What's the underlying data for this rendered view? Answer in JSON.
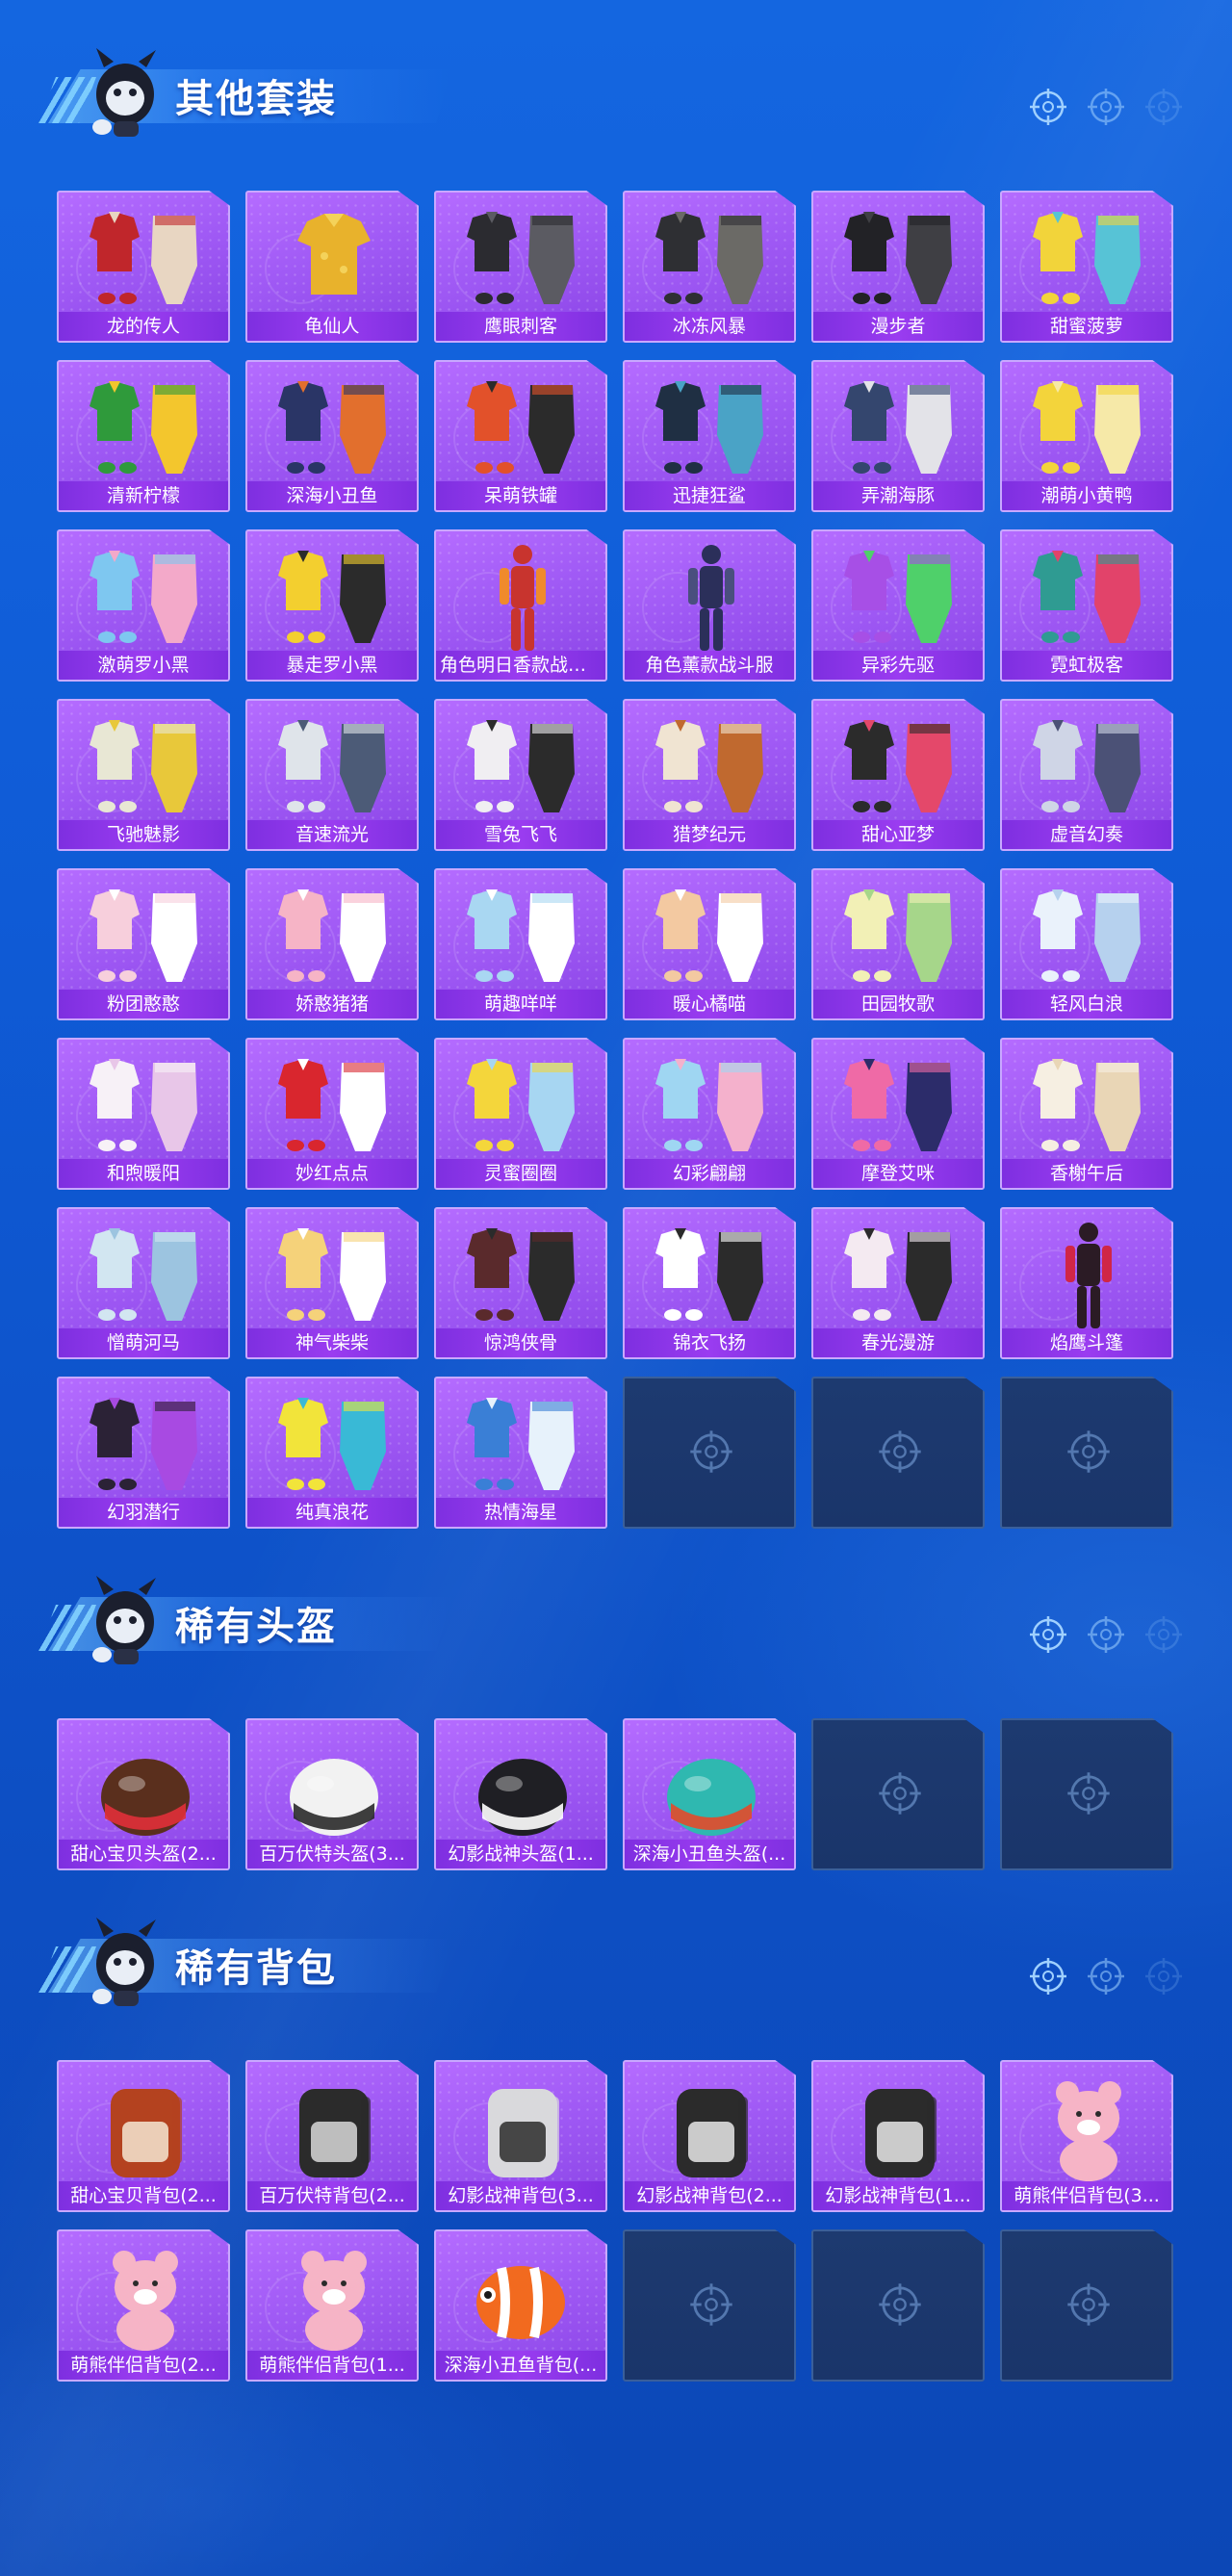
{
  "sections": [
    {
      "title": "其他套装",
      "items": [
        {
          "label": "龙的传人",
          "palette": [
            "#c0262b",
            "#e8d6c2"
          ],
          "shape": "outfit"
        },
        {
          "label": "龟仙人",
          "palette": [
            "#e8b22c",
            "#f4d25a"
          ],
          "shape": "shirt"
        },
        {
          "label": "鹰眼刺客",
          "palette": [
            "#2b2b30",
            "#5b5b62"
          ],
          "shape": "outfit"
        },
        {
          "label": "冰冻风暴",
          "palette": [
            "#2e2f33",
            "#6b6a66"
          ],
          "shape": "outfit"
        },
        {
          "label": "漫步者",
          "palette": [
            "#222226",
            "#3f3f44"
          ],
          "shape": "outfit"
        },
        {
          "label": "甜蜜菠萝",
          "palette": [
            "#f2d43a",
            "#57c3d6"
          ],
          "shape": "outfit"
        },
        {
          "label": "清新柠檬",
          "palette": [
            "#2f9a3b",
            "#f3c62d"
          ],
          "shape": "outfit"
        },
        {
          "label": "深海小丑鱼",
          "palette": [
            "#2a3566",
            "#e26f2d"
          ],
          "shape": "outfit"
        },
        {
          "label": "呆萌铁罐",
          "palette": [
            "#e2512a",
            "#2b2b2b"
          ],
          "shape": "outfit"
        },
        {
          "label": "迅捷狂鲨",
          "palette": [
            "#1f2f43",
            "#4aa3c6"
          ],
          "shape": "outfit"
        },
        {
          "label": "弄潮海豚",
          "palette": [
            "#34466e",
            "#e3e3e8"
          ],
          "shape": "outfit"
        },
        {
          "label": "潮萌小黄鸭",
          "palette": [
            "#f3d43b",
            "#f6e9a8"
          ],
          "shape": "outfit"
        },
        {
          "label": "激萌罗小黑",
          "palette": [
            "#7ec7f0",
            "#f3a9c9"
          ],
          "shape": "outfit"
        },
        {
          "label": "暴走罗小黑",
          "palette": [
            "#f3cf2f",
            "#2b2b2b"
          ],
          "shape": "outfit"
        },
        {
          "label": "角色明日香款战斗服",
          "palette": [
            "#c8342e",
            "#f08a2c"
          ],
          "shape": "figure"
        },
        {
          "label": "角色薰款战斗服",
          "palette": [
            "#2b2f5a",
            "#4a4f7e"
          ],
          "shape": "figure"
        },
        {
          "label": "异彩先驱",
          "palette": [
            "#a74fe6",
            "#4fd06a"
          ],
          "shape": "outfit"
        },
        {
          "label": "霓虹极客",
          "palette": [
            "#2f9b92",
            "#e2436a"
          ],
          "shape": "outfit"
        },
        {
          "label": "飞驰魅影",
          "palette": [
            "#e8e7d4",
            "#e8c83a"
          ],
          "shape": "outfit"
        },
        {
          "label": "音速流光",
          "palette": [
            "#dfe4ea",
            "#4c5b77"
          ],
          "shape": "outfit"
        },
        {
          "label": "雪兔飞飞",
          "palette": [
            "#f0eef2",
            "#2b2b2b"
          ],
          "shape": "outfit"
        },
        {
          "label": "猎梦纪元",
          "palette": [
            "#f0e4d2",
            "#c0692f"
          ],
          "shape": "outfit"
        },
        {
          "label": "甜心亚梦",
          "palette": [
            "#2b2b2b",
            "#e4486a"
          ],
          "shape": "outfit"
        },
        {
          "label": "虚音幻奏",
          "palette": [
            "#cfd5e6",
            "#4b5176"
          ],
          "shape": "outfit"
        },
        {
          "label": "粉团憨憨",
          "palette": [
            "#f7cfdc",
            "#ffffff"
          ],
          "shape": "outfit"
        },
        {
          "label": "娇憨猪猪",
          "palette": [
            "#f6b4c6",
            "#ffffff"
          ],
          "shape": "outfit"
        },
        {
          "label": "萌趣咩咩",
          "palette": [
            "#a9d7f2",
            "#ffffff"
          ],
          "shape": "outfit"
        },
        {
          "label": "暖心橘喵",
          "palette": [
            "#f3c9a1",
            "#ffffff"
          ],
          "shape": "outfit"
        },
        {
          "label": "田园牧歌",
          "palette": [
            "#f2f0b6",
            "#a6d68a"
          ],
          "shape": "outfit"
        },
        {
          "label": "轻风白浪",
          "palette": [
            "#eaf2fb",
            "#b6d1ee"
          ],
          "shape": "outfit"
        },
        {
          "label": "和煦暖阳",
          "palette": [
            "#f7f1f7",
            "#e8c6e8"
          ],
          "shape": "outfit"
        },
        {
          "label": "妙红点点",
          "palette": [
            "#d9262e",
            "#ffffff"
          ],
          "shape": "outfit"
        },
        {
          "label": "灵蜜圈圈",
          "palette": [
            "#f4d63b",
            "#a7d6f2"
          ],
          "shape": "outfit"
        },
        {
          "label": "幻彩翩翩",
          "palette": [
            "#9fd6f2",
            "#f4b1cc"
          ],
          "shape": "outfit"
        },
        {
          "label": "摩登艾咪",
          "palette": [
            "#ef6aa6",
            "#2c2c6a"
          ],
          "shape": "outfit"
        },
        {
          "label": "香榭午后",
          "palette": [
            "#f6efe2",
            "#e9d6b6"
          ],
          "shape": "outfit"
        },
        {
          "label": "憎萌河马",
          "palette": [
            "#d2e6f1",
            "#9cc4e0"
          ],
          "shape": "outfit"
        },
        {
          "label": "神气柴柴",
          "palette": [
            "#f5d27a",
            "#ffffff"
          ],
          "shape": "outfit"
        },
        {
          "label": "惊鸿侠骨",
          "palette": [
            "#5a2a2c",
            "#2b2b2b"
          ],
          "shape": "outfit"
        },
        {
          "label": "锦衣飞扬",
          "palette": [
            "#ffffff",
            "#2b2b2b"
          ],
          "shape": "outfit"
        },
        {
          "label": "春光漫游",
          "palette": [
            "#f4eaf1",
            "#2b2b2b"
          ],
          "shape": "outfit"
        },
        {
          "label": "焰鹰斗篷",
          "palette": [
            "#2b1b25",
            "#d02646"
          ],
          "shape": "figure"
        },
        {
          "label": "幻羽潜行",
          "palette": [
            "#2b2236",
            "#a84ae2"
          ],
          "shape": "outfit"
        },
        {
          "label": "纯真浪花",
          "palette": [
            "#f2e43a",
            "#39b9d6"
          ],
          "shape": "outfit"
        },
        {
          "label": "热情海星",
          "palette": [
            "#3a7fd6",
            "#e7f2fb"
          ],
          "shape": "outfit"
        },
        {
          "empty": true
        },
        {
          "empty": true
        },
        {
          "empty": true
        }
      ]
    },
    {
      "title": "稀有头盔",
      "items": [
        {
          "label": "甜心宝贝头盔(2...",
          "palette": [
            "#5a2f1d",
            "#e0303a"
          ],
          "shape": "helmet"
        },
        {
          "label": "百万伏特头盔(3...",
          "palette": [
            "#f2f2f2",
            "#2a2a2a"
          ],
          "shape": "helmet"
        },
        {
          "label": "幻影战神头盔(1...",
          "palette": [
            "#1f1f24",
            "#ffffff"
          ],
          "shape": "helmet"
        },
        {
          "label": "深海小丑鱼头盔(...",
          "palette": [
            "#2fb8b0",
            "#e44a2a"
          ],
          "shape": "helmet"
        },
        {
          "empty": true
        },
        {
          "empty": true
        }
      ]
    },
    {
      "title": "稀有背包",
      "items": [
        {
          "label": "甜心宝贝背包(2...",
          "palette": [
            "#b4421f",
            "#f4e6d2"
          ],
          "shape": "bag"
        },
        {
          "label": "百万伏特背包(2...",
          "palette": [
            "#2b2b2b",
            "#d8d8d8"
          ],
          "shape": "bag"
        },
        {
          "label": "幻影战神背包(3...",
          "palette": [
            "#d9d9dc",
            "#2b2b2b"
          ],
          "shape": "bag"
        },
        {
          "label": "幻影战神背包(2...",
          "palette": [
            "#2b2b2b",
            "#e8e8e8"
          ],
          "shape": "bag"
        },
        {
          "label": "幻影战神背包(1...",
          "palette": [
            "#2b2b2b",
            "#e8e8e8"
          ],
          "shape": "bag"
        },
        {
          "label": "萌熊伴侣背包(3...",
          "palette": [
            "#f6b4c6",
            "#ffffff"
          ],
          "shape": "bear"
        },
        {
          "label": "萌熊伴侣背包(2...",
          "palette": [
            "#f6b4c6",
            "#ffffff"
          ],
          "shape": "bear"
        },
        {
          "label": "萌熊伴侣背包(1...",
          "palette": [
            "#f6b4c6",
            "#ffffff"
          ],
          "shape": "bear"
        },
        {
          "label": "深海小丑鱼背包(...",
          "palette": [
            "#f26a1f",
            "#ffffff"
          ],
          "shape": "fish"
        },
        {
          "empty": true
        },
        {
          "empty": true
        },
        {
          "empty": true
        }
      ]
    }
  ],
  "colors": {
    "card_bg": "#a05af5",
    "card_border": "#c9a8ff",
    "label_bg": "#8a38ea",
    "empty_bg": "#1d3a70",
    "page_bg": "#1060dc"
  },
  "icons": {
    "section_mascot": "mascot-icon",
    "header_decor": "crosshair-icon",
    "empty_slot": "crosshair-icon"
  }
}
